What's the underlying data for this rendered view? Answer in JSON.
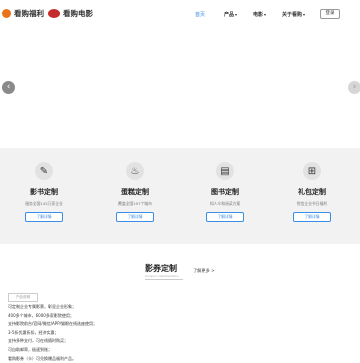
{
  "header": {
    "brand1": {
      "text": "看购福利",
      "icon": "orange-circle-logo"
    },
    "brand2": {
      "text": "看购电影",
      "icon": "red-eye-logo"
    },
    "nav": [
      {
        "label": "首页",
        "active": true
      },
      {
        "label": "产品",
        "has_dropdown": true
      },
      {
        "label": "电影",
        "has_dropdown": true
      },
      {
        "label": "关于看购",
        "has_dropdown": true
      }
    ],
    "login_label": "登录"
  },
  "banner": {
    "prev_icon": "chevron-left-icon",
    "next_icon": "chevron-right-icon"
  },
  "services": [
    {
      "icon": "ticket-icon",
      "title": "影书定制",
      "desc": "服务全国145万家企业",
      "button": "了解详情"
    },
    {
      "icon": "cake-icon",
      "title": "蛋糕定制",
      "desc": "覆盖全国197个城市",
      "button": "了解详情"
    },
    {
      "icon": "book-icon",
      "title": "图书定制",
      "desc": "知人众和阅读方案",
      "button": "了解详情"
    },
    {
      "icon": "gift-icon",
      "title": "礼包定制",
      "desc": "悦信企业节日福利",
      "button": "了解详情"
    }
  ],
  "section": {
    "title": "影券定制",
    "subtitle": "Coupon customization",
    "more": "了解更多 >",
    "intro_label": "产品说明",
    "lines": [
      "可定制企业专属影票，彰显企业形象；",
      "400多个城市，6000多家影院使用；",
      "支持影院前台/官网/微信/APP/猫眼在线选座使用；",
      "3-5折优惠折扣，经济实惠；",
      "支持多种支付，可在线随时购买；",
      "可自助邮寄，极速到账；",
      "看购影券（卡）可兑换爆品福利产品。"
    ]
  },
  "colors": {
    "accent": "#3a8ee6",
    "orange": "#e8731a",
    "red": "#c32d2d",
    "section_bg": "#f2f2f2"
  }
}
